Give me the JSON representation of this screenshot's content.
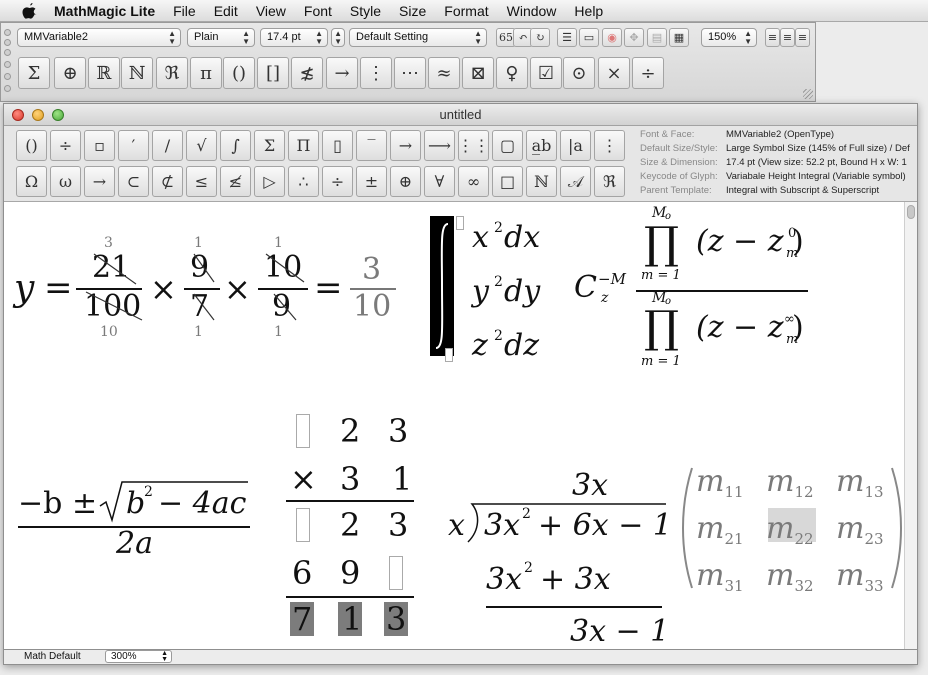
{
  "menubar": {
    "app_name": "MathMagic Lite",
    "items": [
      "File",
      "Edit",
      "View",
      "Font",
      "Style",
      "Size",
      "Format",
      "Window",
      "Help"
    ]
  },
  "palette": {
    "font_popup": "MMVariable2",
    "style_popup": "Plain",
    "size_popup": "17.4 pt",
    "setting_popup": "Default Setting",
    "zoom_popup": "150%",
    "symbols": [
      "Σ",
      "⊕",
      "ℝ",
      "ℕ",
      "ℜ",
      "π",
      "()",
      "[]",
      "≴",
      "→",
      "⋮",
      "⋯",
      "≈",
      "⊠",
      "♀",
      "☑",
      "⊙",
      "×",
      "÷"
    ]
  },
  "document": {
    "title": "untitled",
    "toolbar_row1": [
      "()",
      "÷",
      "▫",
      "′",
      "/",
      "√",
      "∫",
      "Σ",
      "Π",
      "▯",
      "‾",
      "→",
      "⟶",
      "⋮⋮",
      "▢",
      "a̲b",
      "|a",
      "⋮"
    ],
    "toolbar_row2": [
      "Ω",
      "ω",
      "→",
      "⊂",
      "⊄",
      "≤",
      "≰",
      "▷",
      "∴",
      "÷",
      "±",
      "⊕",
      "∀",
      "∞",
      "□",
      "ℕ",
      "𝒜",
      "ℜ"
    ],
    "info": [
      {
        "key": "Font & Face:",
        "value": "MMVariable2  (OpenType)"
      },
      {
        "key": "Default Size/Style:",
        "value": "Large Symbol Size (145% of Full size)  /  Def"
      },
      {
        "key": "Size & Dimension:",
        "value": "17.4 pt  (View size: 52.2 pt, Bound H x W: 1"
      },
      {
        "key": "Keycode of Glyph:",
        "value": "Variabale Height Integral (Variable symbol)"
      },
      {
        "key": "Parent Template:",
        "value": "Integral with Subscript & Superscript"
      }
    ]
  },
  "equations": {
    "fraction_product": {
      "y": "y",
      "eq": "=",
      "times": "×",
      "f1_num": "21",
      "f1_den": "100",
      "f1_num_red": "3",
      "f1_den_red": "10",
      "f2_num": "9",
      "f2_den": "7",
      "f2_num_red": "1",
      "f2_den_red": "1",
      "f3_num": "10",
      "f3_den": "9",
      "f3_num_red": "1",
      "f3_den_red": "1",
      "result_num": "3",
      "result_den": "10"
    },
    "integral": {
      "line1": "x",
      "line1_var": "dx",
      "line2": "y",
      "line2_var": "dy",
      "line3": "z",
      "line3_var": "dz",
      "exp": "2"
    },
    "product": {
      "C": "C",
      "sup": "−M",
      "sub": "z",
      "top_limit": "M",
      "top_limit_sub": "o",
      "bottom_limit": "m = 1",
      "num_factor": "(z − z",
      "num_sup": "0",
      "num_sub": "m",
      "close": ")",
      "den_sup": "∞",
      "den_sub": "m"
    },
    "quadratic": {
      "neg_b": "−b",
      "pm": "±",
      "radicand": "b",
      "exp": "2",
      "rest": "− 4ac",
      "den": "2a"
    },
    "multiplication": {
      "row1": [
        "2",
        "3"
      ],
      "row2_op": "×",
      "row2": [
        "3",
        "1"
      ],
      "row3": [
        "2",
        "3"
      ],
      "row4": [
        "6",
        "9"
      ],
      "row5": [
        "7",
        "1",
        "3"
      ]
    },
    "long_division": {
      "quotient": "3x",
      "divisor": "x",
      "dividend": "3x",
      "dividend_rest": "+ 6x − 1",
      "exp": "2",
      "sub1": "3x",
      "sub1_rest": "+ 3x",
      "remainder": "3x − 1"
    },
    "matrix": {
      "base": "m",
      "cells": [
        [
          "11",
          "12",
          "13"
        ],
        [
          "21",
          "22",
          "23"
        ],
        [
          "31",
          "32",
          "33"
        ]
      ]
    }
  },
  "status": {
    "style": "Math Default",
    "zoom": "300%"
  }
}
